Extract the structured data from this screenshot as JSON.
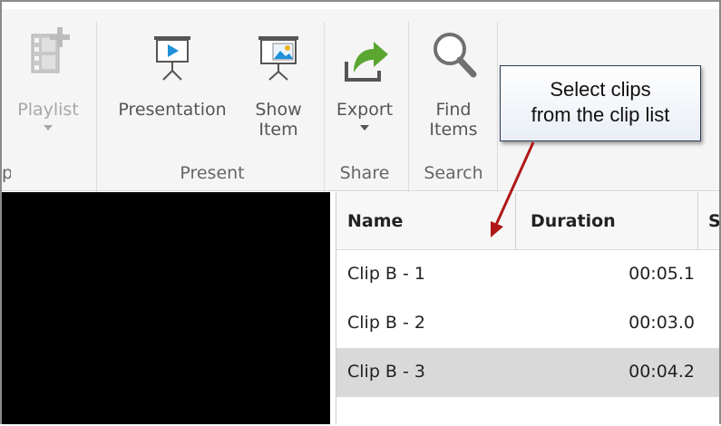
{
  "ribbon": {
    "groups": [
      {
        "label": "p"
      },
      {
        "label": "Present"
      },
      {
        "label": "Share"
      },
      {
        "label": "Search"
      }
    ],
    "playlist": {
      "label": "Playlist",
      "icon": "playlist-add-icon"
    },
    "presentation": {
      "label": "Presentation",
      "icon": "projector-play-icon"
    },
    "show_item": {
      "label_line1": "Show",
      "label_line2": "Item",
      "icon": "projector-image-icon"
    },
    "export": {
      "label": "Export",
      "icon": "export-arrow-icon"
    },
    "find_items": {
      "label_line1": "Find",
      "label_line2": "Items",
      "icon": "magnifier-icon"
    }
  },
  "callout": {
    "line1": "Select clips",
    "line2": "from the clip list"
  },
  "clip_list": {
    "columns": [
      "Name",
      "Duration",
      "S"
    ],
    "rows": [
      {
        "name": "Clip B - 1",
        "duration": "00:05.1",
        "selected": false
      },
      {
        "name": "Clip B - 2",
        "duration": "00:03.0",
        "selected": false
      },
      {
        "name": "Clip B - 3",
        "duration": "00:04.2",
        "selected": true
      }
    ]
  },
  "colors": {
    "accent_blue": "#1e90d8",
    "export_green": "#5aa630",
    "arrow_red": "#b01818",
    "selected_row": "#d9d9d9"
  }
}
